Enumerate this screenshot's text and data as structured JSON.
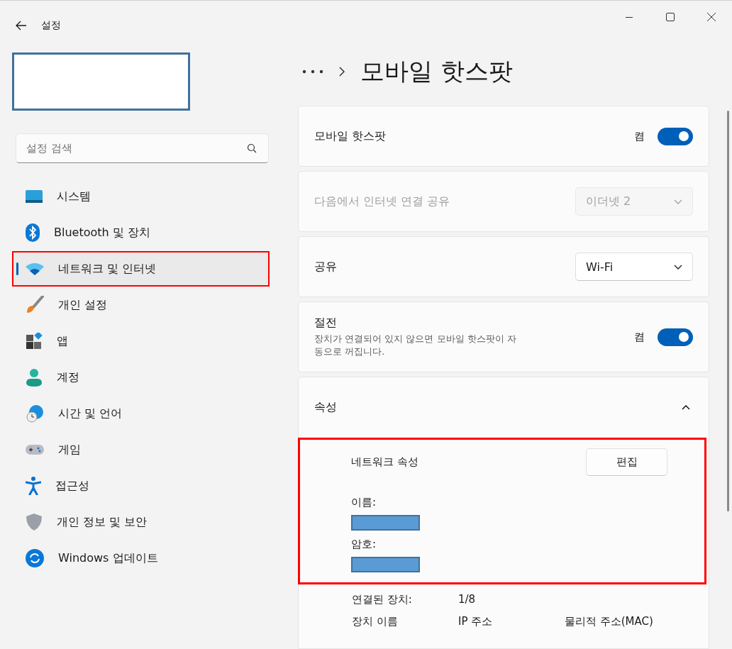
{
  "window": {
    "title": "설정"
  },
  "search": {
    "placeholder": "설정 검색"
  },
  "nav": [
    {
      "label": "시스템",
      "selected": false,
      "highlighted": false
    },
    {
      "label": "Bluetooth 및 장치",
      "selected": false,
      "highlighted": false
    },
    {
      "label": "네트워크 및 인터넷",
      "selected": true,
      "highlighted": true
    },
    {
      "label": "개인 설정",
      "selected": false,
      "highlighted": false
    },
    {
      "label": "앱",
      "selected": false,
      "highlighted": false
    },
    {
      "label": "계정",
      "selected": false,
      "highlighted": false
    },
    {
      "label": "시간 및 언어",
      "selected": false,
      "highlighted": false
    },
    {
      "label": "게임",
      "selected": false,
      "highlighted": false
    },
    {
      "label": "접근성",
      "selected": false,
      "highlighted": false
    },
    {
      "label": "개인 정보 및 보안",
      "selected": false,
      "highlighted": false
    },
    {
      "label": "Windows 업데이트",
      "selected": false,
      "highlighted": false
    }
  ],
  "page": {
    "title": "모바일 핫스팟"
  },
  "settings": [
    {
      "kind": "toggle",
      "label": "모바일 핫스팟",
      "state_label": "켬",
      "on": true
    },
    {
      "kind": "dropdown",
      "label": "다음에서 인터넷 연결 공유",
      "value": "이더넷 2",
      "disabled": true
    },
    {
      "kind": "dropdown",
      "label": "공유",
      "value": "Wi-Fi",
      "disabled": false
    },
    {
      "kind": "toggle",
      "label": "절전",
      "description": "장치가 연결되어 있지 않으면 모바일 핫스팟이 자동으로 꺼집니다.",
      "state_label": "켬",
      "on": true
    },
    {
      "kind": "expander",
      "label": "속성",
      "expanded": true
    }
  ],
  "properties": {
    "highlighted": true,
    "title": "네트워크 속성",
    "edit_button": "편집",
    "fields": [
      {
        "label": "이름:"
      },
      {
        "label": "암호:"
      }
    ],
    "connected_label": "연결된 장치:",
    "connected_value": "1/8",
    "columns": [
      "장치 이름",
      "IP 주소",
      "물리적 주소(MAC)"
    ]
  }
}
